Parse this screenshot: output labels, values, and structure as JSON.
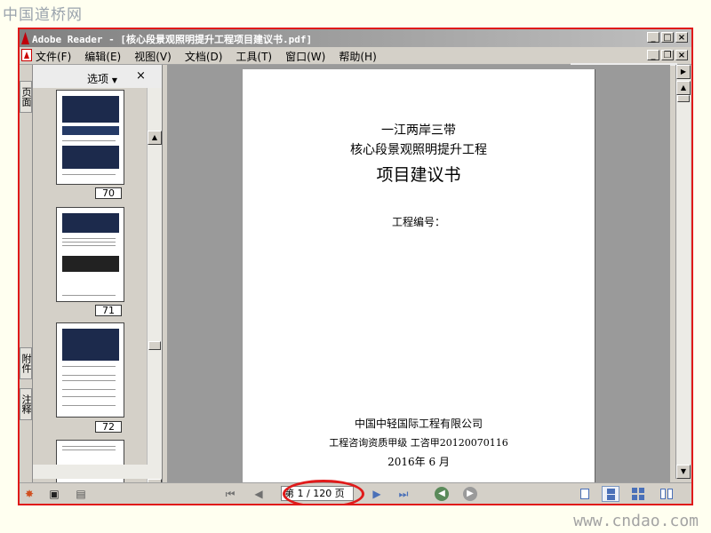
{
  "watermark": {
    "top": "中国道桥网",
    "bottom": "www.cndao.com"
  },
  "window": {
    "title": "Adobe Reader - [核心段景观照明提升工程项目建议书.pdf]"
  },
  "menu": [
    {
      "label": "文件(F)"
    },
    {
      "label": "编辑(E)"
    },
    {
      "label": "视图(V)"
    },
    {
      "label": "文档(D)"
    },
    {
      "label": "工具(T)"
    },
    {
      "label": "窗口(W)"
    },
    {
      "label": "帮助(H)"
    }
  ],
  "window_buttons": {
    "minimize": "_",
    "maximize": "□",
    "restore": "❐",
    "close": "×"
  },
  "sidebar": {
    "tabs": [
      "页面",
      "附件",
      "注释"
    ],
    "options_label": "选项",
    "close_label": "×",
    "thumbnails": [
      {
        "page": "70"
      },
      {
        "page": "71"
      },
      {
        "page": "72"
      }
    ]
  },
  "document": {
    "title_line1": "一江两岸三带",
    "title_line2": "核心段景观照明提升工程",
    "title_line3": "项目建议书",
    "project_number_label": "工程编号：",
    "company": "中国中轻国际工程有限公司",
    "qualification": "工程咨询资质甲级  工咨甲20120070116",
    "date": "2016年  6  月"
  },
  "statusbar": {
    "page_indicator": "第 1 / 120 页",
    "current_page": 1,
    "total_pages": 120
  },
  "colors": {
    "callout": "#e01a1a",
    "frame": "#e01a1a"
  }
}
